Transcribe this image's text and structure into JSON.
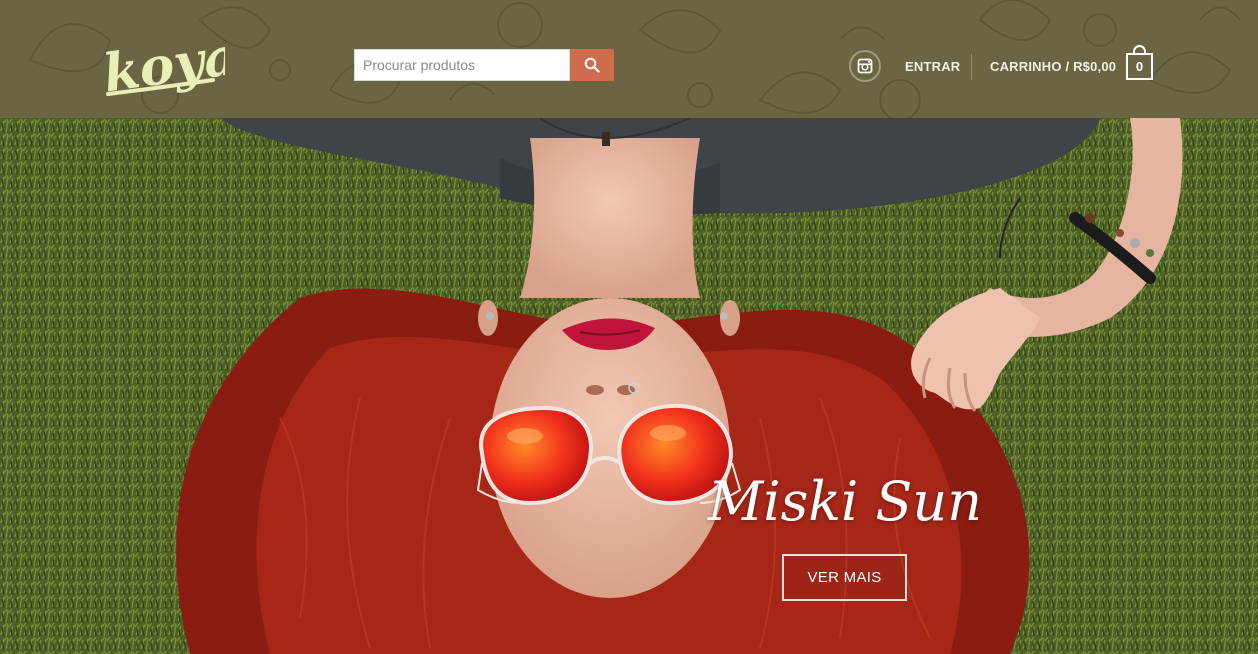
{
  "header": {
    "logo_text": "koya",
    "search": {
      "placeholder": "Procurar produtos",
      "value": ""
    },
    "search_button_icon": "search-icon",
    "social_icon": "instagram-icon",
    "login_label": "ENTRAR",
    "cart_label": "CARRINHO / R$0,00",
    "cart_count": "0",
    "cart_icon": "shopping-bag-icon"
  },
  "hero": {
    "title": "Miski Sun",
    "button_label": "VER MAIS"
  },
  "colors": {
    "header_bg": "#6b6544",
    "search_button": "#cf6c4c",
    "logo": "#e9efb7",
    "text_light": "#f2efe3"
  }
}
